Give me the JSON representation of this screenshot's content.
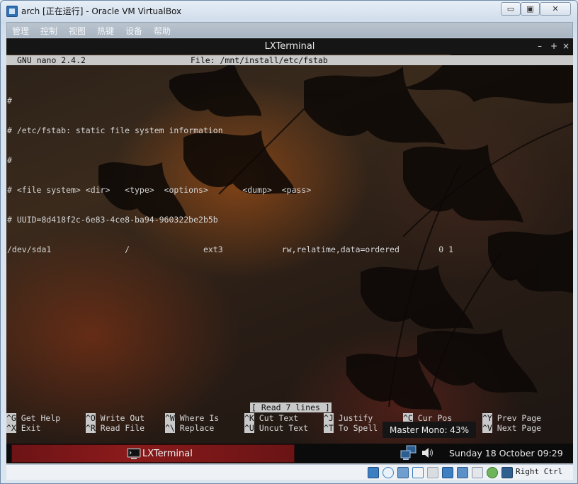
{
  "window": {
    "title": "arch [正在运行] - Oracle VM VirtualBox",
    "controls": {
      "minimize": "▭",
      "maximize": "▣",
      "close": "✕"
    }
  },
  "vb_menu": [
    "管理",
    "控制",
    "视图",
    "热键",
    "设备",
    "帮助"
  ],
  "terminal": {
    "title": "LXTerminal",
    "controls": [
      "–",
      "+",
      "×"
    ]
  },
  "nano": {
    "version": "GNU nano 2.4.2",
    "file": "File: /mnt/install/etc/fstab",
    "lines": [
      "#",
      "# /etc/fstab: static file system information",
      "#",
      "# <file system> <dir>   <type>  <options>       <dump>  <pass>",
      "# UUID=8d418f2c-6e83-4ce8-ba94-960322be2b5b",
      "/dev/sda1               /               ext3            rw,relatime,data=ordered        0 1"
    ],
    "status": "[ Read 7 lines ]",
    "shortcuts_row1": [
      {
        "key": "^G",
        "label": "Get Help"
      },
      {
        "key": "^O",
        "label": "Write Out"
      },
      {
        "key": "^W",
        "label": "Where Is"
      },
      {
        "key": "^K",
        "label": "Cut Text"
      },
      {
        "key": "^J",
        "label": "Justify"
      },
      {
        "key": "^C",
        "label": "Cur Pos"
      },
      {
        "key": "^Y",
        "label": "Prev Page"
      }
    ],
    "shortcuts_row2": [
      {
        "key": "^X",
        "label": "Exit"
      },
      {
        "key": "^R",
        "label": "Read File"
      },
      {
        "key": "^\\",
        "label": "Replace"
      },
      {
        "key": "^U",
        "label": "Uncut Text"
      },
      {
        "key": "^T",
        "label": "To Spell"
      },
      {
        "key": "",
        "label": ""
      },
      {
        "key": "^V",
        "label": "Next Page"
      }
    ]
  },
  "tooltip": "Master Mono: 43%",
  "panel": {
    "task_label": "LXTerminal",
    "clock": "Sunday 18 October 09:29",
    "icons": [
      "terminal-icon",
      "network-icon",
      "volume-icon"
    ]
  },
  "vb_status": {
    "icons": [
      "hard-disk-icon",
      "optical-drive-icon",
      "network-adapter-icon",
      "usb-icon",
      "shared-folder-icon",
      "display-icon",
      "drag-drop-icon",
      "video-capture-icon",
      "cpu-vt-icon",
      "mouse-integration-icon"
    ],
    "host_key": "Right Ctrl"
  }
}
